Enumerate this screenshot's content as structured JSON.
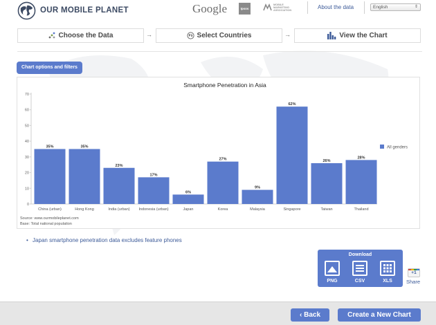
{
  "header": {
    "logo_text": "OUR MOBILE PLANET",
    "google": "Google",
    "ipsos": "Ipsos",
    "mma": "MOBILE MARKETING ASSOCIATION",
    "about_link": "About the data",
    "language": "English"
  },
  "steps": {
    "choose": "Choose the Data",
    "countries": "Select Countries",
    "view": "View the Chart",
    "arrow": "→"
  },
  "options_button": "Chart options and filters",
  "chart_data": {
    "type": "bar",
    "title": "Smartphone Penetration in Asia",
    "categories": [
      "China (urban)",
      "Hong Kong",
      "India (urban)",
      "Indonesia (urban)",
      "Japan",
      "Korea",
      "Malaysia",
      "Singapore",
      "Taiwan",
      "Thailand"
    ],
    "series": [
      {
        "name": "All genders",
        "values": [
          35,
          35,
          23,
          17,
          6,
          27,
          9,
          62,
          26,
          28
        ],
        "labels": [
          "35%",
          "35%",
          "23%",
          "17%",
          "6%",
          "27%",
          "9%",
          "62%",
          "26%",
          "28%"
        ]
      }
    ],
    "ylim": [
      0,
      70
    ],
    "yticks": [
      0,
      10,
      20,
      30,
      40,
      50,
      60,
      70
    ],
    "ytick_labels": [
      "0",
      "10",
      "20",
      "30",
      "40",
      "50",
      "60",
      "70"
    ],
    "grid": false,
    "legend": "right",
    "color": "#5b7bcc",
    "xlabel": "",
    "ylabel": ""
  },
  "source": {
    "line1": "Source: www.ourmobileplanet.com",
    "line2": "Base:   Total national population"
  },
  "note": "Japan smartphone penetration data excludes feature phones",
  "note_bullet": "•",
  "download": {
    "title": "Download",
    "png": "PNG",
    "csv": "CSV",
    "xls": "XLS"
  },
  "share": {
    "gplus": "+1",
    "label": "Share"
  },
  "footer": {
    "back": "‹  Back",
    "create": "Create a New Chart"
  },
  "colors": {
    "accent": "#5b7bcc",
    "link": "#3c5a98",
    "footer_bg": "#e6e6e6"
  }
}
